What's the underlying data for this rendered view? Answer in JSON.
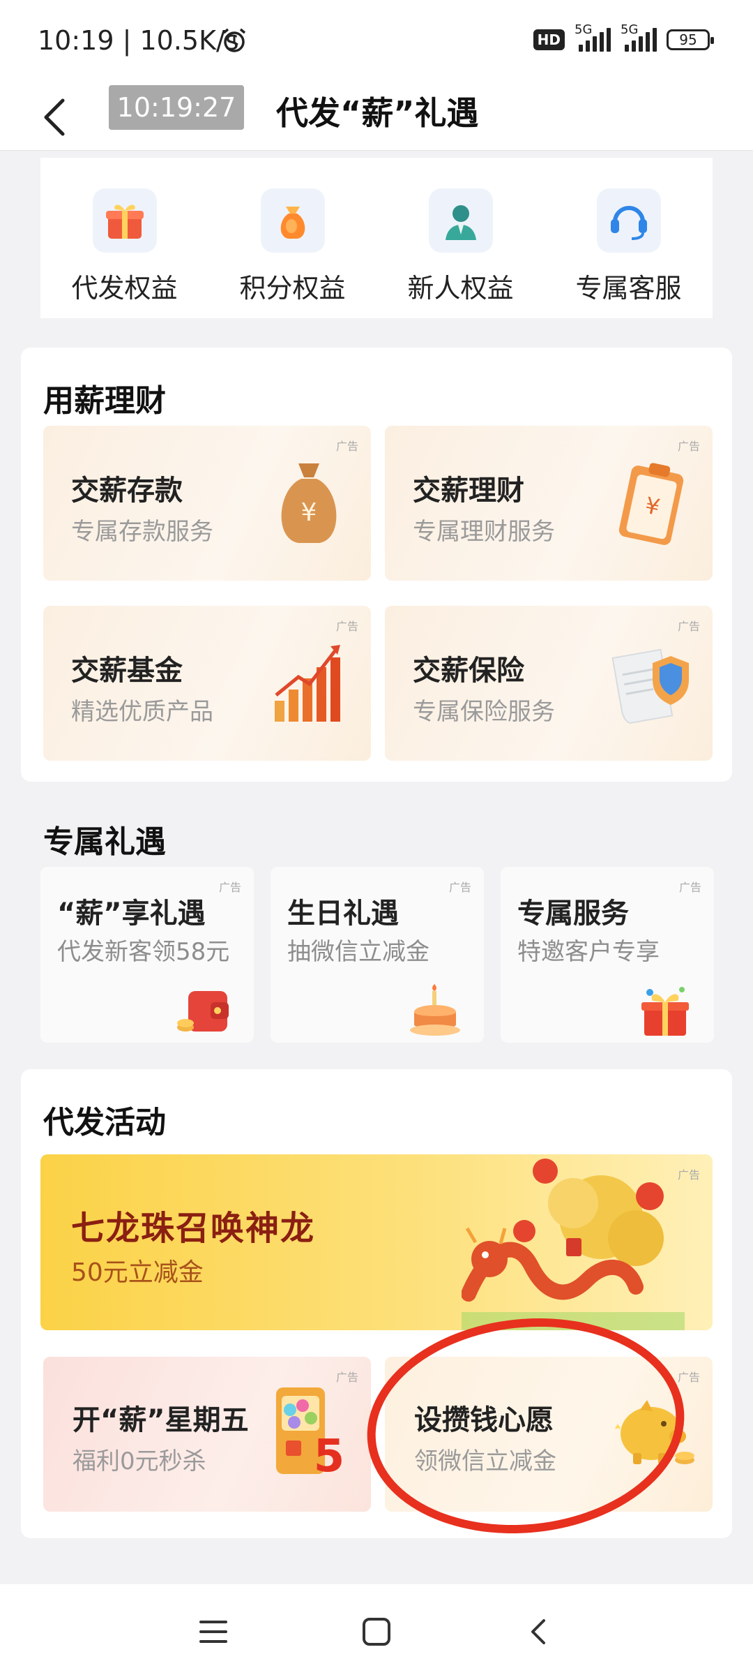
{
  "status_bar": {
    "time": "10:19 | 10.5K/s",
    "hd": "HD",
    "signal1": "5G",
    "signal2": "5G",
    "battery": "95"
  },
  "header": {
    "time_chip": "10:19:27",
    "title": "代发“薪”礼遇"
  },
  "quick_entries": [
    {
      "label": "代发权益",
      "icon": "gift-icon"
    },
    {
      "label": "积分权益",
      "icon": "bag-icon"
    },
    {
      "label": "新人权益",
      "icon": "person-icon"
    },
    {
      "label": "专属客服",
      "icon": "headset-icon"
    }
  ],
  "wealth": {
    "title": "用薪理财",
    "ad": "广告",
    "cards": [
      {
        "title": "交薪存款",
        "subtitle": "专属存款服务",
        "icon": "money-bag-icon"
      },
      {
        "title": "交薪理财",
        "subtitle": "专属理财服务",
        "icon": "clipboard-yuan-icon"
      },
      {
        "title": "交薪基金",
        "subtitle": "精选优质产品",
        "icon": "growth-chart-icon"
      },
      {
        "title": "交薪保险",
        "subtitle": "专属保险服务",
        "icon": "shield-document-icon"
      }
    ]
  },
  "perks": {
    "title": "专属礼遇",
    "ad": "广告",
    "cards": [
      {
        "title": "“薪”享礼遇",
        "subtitle": "代发新客领58元",
        "icon": "wallet-icon"
      },
      {
        "title": "生日礼遇",
        "subtitle": "抽微信立减金",
        "icon": "cake-icon"
      },
      {
        "title": "专属服务",
        "subtitle": "特邀客户专享",
        "icon": "gift-box-icon"
      }
    ]
  },
  "activities": {
    "title": "代发活动",
    "ad": "广告",
    "banner": {
      "title": "七龙珠召唤神龙",
      "subtitle": "50元立减金",
      "icon": "dragon-icon"
    },
    "cards": [
      {
        "title": "开“薪”星期五",
        "subtitle": "福利0元秒杀",
        "icon": "gacha-machine-icon",
        "badge": "5"
      },
      {
        "title": "设攒钱心愿",
        "subtitle": "领微信立减金",
        "icon": "piggy-bank-icon"
      }
    ]
  },
  "colors": {
    "accent_red": "#e8301e",
    "banner_title": "#8a1f12",
    "banner_gold": "#fbd247"
  }
}
